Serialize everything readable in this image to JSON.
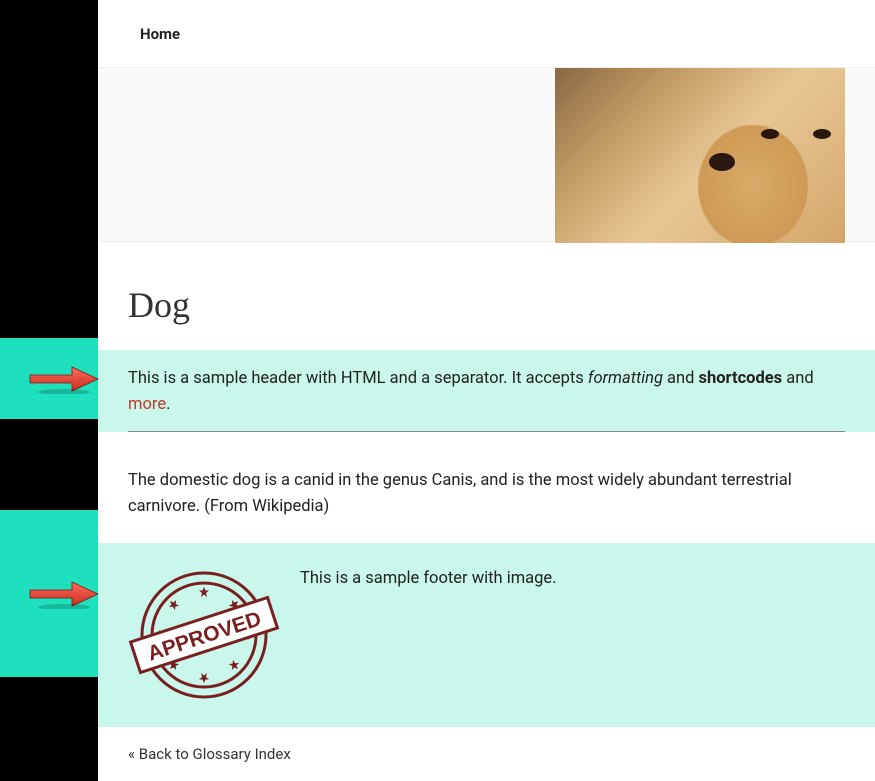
{
  "nav": {
    "home": "Home"
  },
  "article": {
    "title": "Dog",
    "sample_header": {
      "prefix": "This is a sample header with HTML and a separator. It accepts ",
      "italic": "formatting",
      "mid": " and ",
      "bold": "shortcodes",
      "after_bold": " and ",
      "link": "more",
      "suffix": "."
    },
    "body": "The domestic dog is a canid in the genus Canis, and is the most widely abundant terrestrial carnivore. (From Wikipedia)",
    "sample_footer": "This is a sample footer with image.",
    "stamp_label": "APPROVED"
  },
  "back_link": "« Back to Glossary Index"
}
